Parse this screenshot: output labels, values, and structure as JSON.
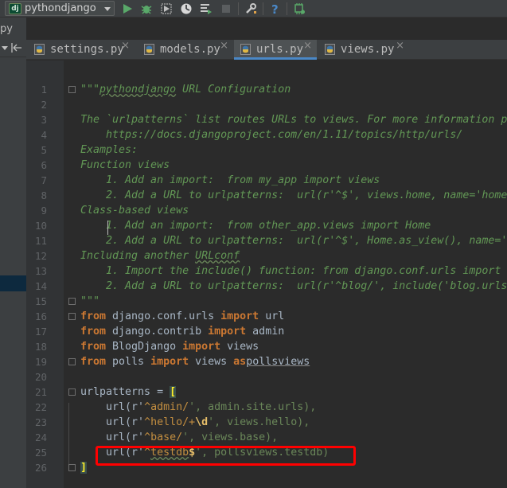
{
  "toolbar": {
    "run_config": "pythondjango",
    "dj_badge": "dj",
    "icons": [
      "run-icon",
      "debug-icon",
      "coverage-icon",
      "profile-icon",
      "concurrency-icon",
      "stop-icon",
      "settings-icon",
      "help-icon",
      "sdk-icon"
    ]
  },
  "breadcrumb": "py",
  "tabs": [
    {
      "label": "settings.py",
      "close": "×"
    },
    {
      "label": "models.py",
      "close": "×"
    },
    {
      "label": "urls.py",
      "close": "×"
    },
    {
      "label": "views.py",
      "close": "×"
    }
  ],
  "lines": [
    {
      "n": "1"
    },
    {
      "n": "2"
    },
    {
      "n": "3"
    },
    {
      "n": "4"
    },
    {
      "n": "5"
    },
    {
      "n": "6"
    },
    {
      "n": "7"
    },
    {
      "n": "8"
    },
    {
      "n": "9"
    },
    {
      "n": "10"
    },
    {
      "n": "11"
    },
    {
      "n": "12"
    },
    {
      "n": "13"
    },
    {
      "n": "14"
    },
    {
      "n": "15"
    },
    {
      "n": "16"
    },
    {
      "n": "17"
    },
    {
      "n": "18"
    },
    {
      "n": "19"
    },
    {
      "n": "20"
    },
    {
      "n": "21"
    },
    {
      "n": "22"
    },
    {
      "n": "23"
    },
    {
      "n": "24"
    },
    {
      "n": "25"
    },
    {
      "n": "26"
    }
  ],
  "code": {
    "l1_q": "\"\"\"",
    "l1_a": "pythondjango",
    "l1_b": " URL Configuration",
    "l3": "The `urlpatterns` list routes URLs to views. For more information p",
    "l4": "    https://docs.djangoproject.com/en/1.11/topics/http/urls/",
    "l5": "Examples:",
    "l6": "Function views",
    "l7": "    1. Add an import:  from my_app import views",
    "l8": "    2. Add a URL to urlpatterns:  url(r'^$', views.home, name='home",
    "l9": "Class-based views",
    "l10": "    1. Add an import:  from other_app.views import Home",
    "l11": "    2. Add a URL to urlpatterns:  url(r'^$', Home.as_view(), name='",
    "l12_a": "Including another ",
    "l12_b": "URLconf",
    "l13": "    1. Import the include() function: from django.conf.urls import ",
    "l14": "    2. Add a URL to urlpatterns:  url(r'^blog/', include('blog.urls",
    "l15": "\"\"\"",
    "kw_from": "from",
    "kw_import": "import",
    "kw_as": "as",
    "l16_mod": " django.conf.urls ",
    "l16_name": " url",
    "l17_mod": " django.contrib ",
    "l17_name": " admin",
    "l18_mod": " BlogDjango ",
    "l18_name": " views",
    "l19_mod": " polls ",
    "l19_name": " views ",
    "l19_alias": "pollsviews",
    "l21_a": "urlpatterns = ",
    "l21_b": "[",
    "url_open": "    url(r'",
    "l22_re": "^admin/",
    "l22_rest": "', admin.site.urls),",
    "l23_re1": "^hello/+",
    "l23_re2": "\\d",
    "l23_rest": "', views.hello),",
    "l24_re": "^base/",
    "l24_rest": "', views.base),",
    "l25_re1": "^",
    "l25_re2": "testdb",
    "l25_re3": "$",
    "l25_rest": "', pollsviews.testdb)",
    "l26": "]"
  },
  "colors": {
    "background": "#2b2b2b",
    "docstring": "#629755",
    "keyword": "#cc7832",
    "string": "#6a8759",
    "highlight_box": "#ff0000",
    "active_tab_underline": "#4a88c7"
  }
}
